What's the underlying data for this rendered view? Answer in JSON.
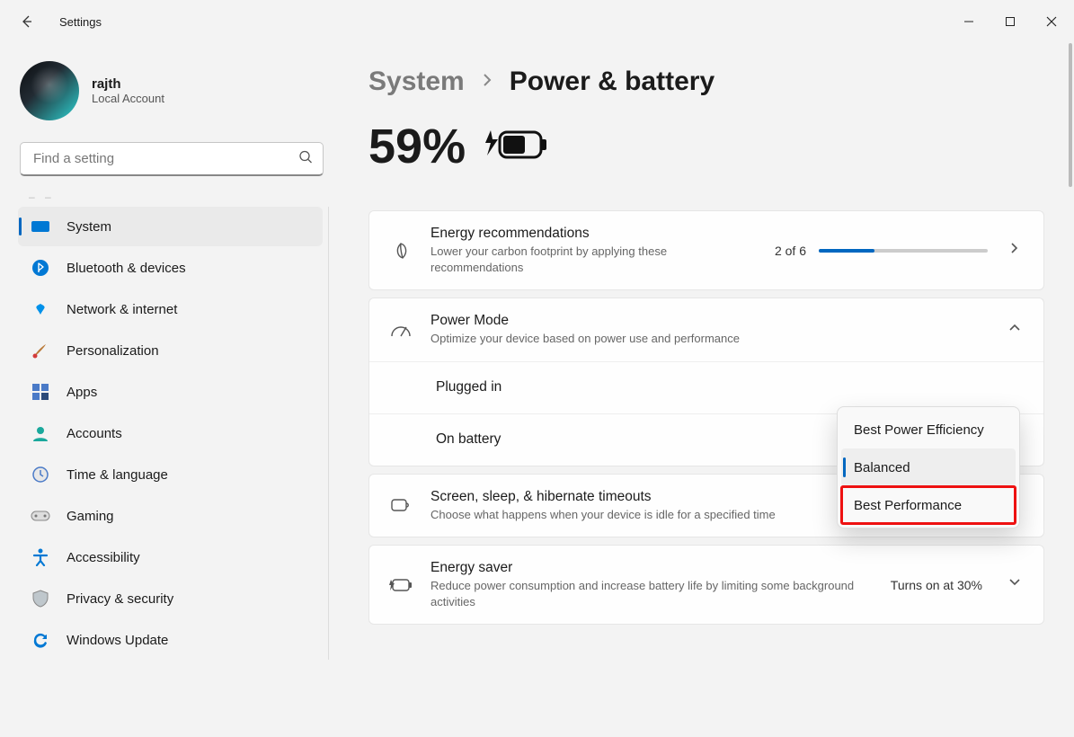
{
  "window": {
    "title": "Settings"
  },
  "profile": {
    "username": "rajth",
    "account_type": "Local Account"
  },
  "search": {
    "placeholder": "Find a setting"
  },
  "breadcrumb": {
    "parent": "System",
    "page": "Power & battery"
  },
  "battery": {
    "percent": "59%"
  },
  "nav": {
    "items": [
      {
        "label": "System",
        "icon": "system",
        "active": true
      },
      {
        "label": "Bluetooth & devices",
        "icon": "bluetooth",
        "active": false
      },
      {
        "label": "Network & internet",
        "icon": "wifi",
        "active": false
      },
      {
        "label": "Personalization",
        "icon": "brush",
        "active": false
      },
      {
        "label": "Apps",
        "icon": "apps",
        "active": false
      },
      {
        "label": "Accounts",
        "icon": "accounts",
        "active": false
      },
      {
        "label": "Time & language",
        "icon": "time",
        "active": false
      },
      {
        "label": "Gaming",
        "icon": "gaming",
        "active": false
      },
      {
        "label": "Accessibility",
        "icon": "accessibility",
        "active": false
      },
      {
        "label": "Privacy & security",
        "icon": "privacy",
        "active": false
      },
      {
        "label": "Windows Update",
        "icon": "update",
        "active": false
      }
    ]
  },
  "cards": {
    "energy": {
      "title": "Energy recommendations",
      "sub": "Lower your carbon footprint by applying these recommendations",
      "progress_label": "2 of 6",
      "progress_pct": 33
    },
    "power_mode": {
      "title": "Power Mode",
      "sub": "Optimize your device based on power use and performance",
      "sub_rows": [
        "Plugged in",
        "On battery"
      ]
    },
    "timeouts": {
      "title": "Screen, sleep, & hibernate timeouts",
      "sub": "Choose what happens when your device is idle for a specified time"
    },
    "saver": {
      "title": "Energy saver",
      "sub": "Reduce power consumption and increase battery life by limiting some background activities",
      "value": "Turns on at 30%"
    }
  },
  "dropdown": {
    "options": [
      "Best Power Efficiency",
      "Balanced",
      "Best Performance"
    ],
    "selected": "Balanced",
    "highlighted": "Best Performance"
  }
}
